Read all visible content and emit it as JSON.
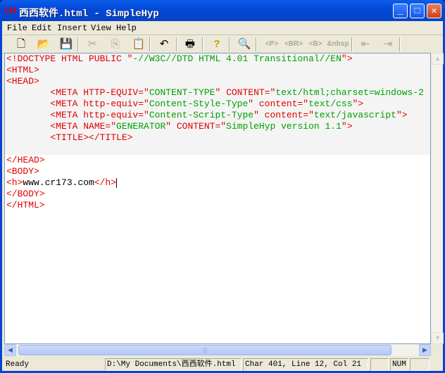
{
  "window": {
    "title": "西西软件.html - SimpleHyp",
    "logo": "SH"
  },
  "menu": [
    "File",
    "Edit",
    "Insert",
    "View",
    "Help"
  ],
  "toolbar": {
    "p": "<P>",
    "br": "<BR>",
    "b": "<B>",
    "nbsp": "&nbsp"
  },
  "code": [
    {
      "bg": true,
      "segs": [
        [
          "<!DOCTYPE HTML PUBLIC \"",
          "tag"
        ],
        [
          "-//W3C//DTD HTML 4.01 Transitional//EN",
          "val"
        ],
        [
          "\">",
          "tag"
        ]
      ]
    },
    {
      "bg": true,
      "segs": [
        [
          "<HTML>",
          "tag"
        ]
      ]
    },
    {
      "bg": true,
      "segs": [
        [
          "<HEAD>",
          "tag"
        ]
      ]
    },
    {
      "bg": true,
      "segs": [
        [
          "        <META HTTP-EQUIV=\"",
          "tag"
        ],
        [
          "CONTENT-TYPE",
          "val"
        ],
        [
          "\" CONTENT=\"",
          "tag"
        ],
        [
          "text/html;charset=windows-2",
          "val"
        ]
      ]
    },
    {
      "bg": true,
      "segs": [
        [
          "        <META http-equiv=\"",
          "tag"
        ],
        [
          "Content-Style-Type",
          "val"
        ],
        [
          "\" content=\"",
          "tag"
        ],
        [
          "text/css",
          "val"
        ],
        [
          "\">",
          "tag"
        ]
      ]
    },
    {
      "bg": true,
      "segs": [
        [
          "        <META http-equiv=\"",
          "tag"
        ],
        [
          "Content-Script-Type",
          "val"
        ],
        [
          "\" content=\"",
          "tag"
        ],
        [
          "text/javascript",
          "val"
        ],
        [
          "\">",
          "tag"
        ]
      ]
    },
    {
      "bg": true,
      "segs": [
        [
          "        <META NAME=\"",
          "tag"
        ],
        [
          "GENERATOR",
          "val"
        ],
        [
          "\" CONTENT=\"",
          "tag"
        ],
        [
          "SimpleHyp version 1.1",
          "val"
        ],
        [
          "\">",
          "tag"
        ]
      ]
    },
    {
      "bg": true,
      "segs": [
        [
          "        <TITLE></TITLE>",
          "tag"
        ]
      ]
    },
    {
      "bg": true,
      "segs": []
    },
    {
      "bg": false,
      "segs": [
        [
          "</HEAD>",
          "tag"
        ]
      ]
    },
    {
      "bg": false,
      "segs": [
        [
          "<BODY>",
          "tag"
        ]
      ]
    },
    {
      "bg": false,
      "caret": true,
      "segs": [
        [
          "<h>",
          "tag"
        ],
        [
          "www.cr173.com",
          "txt"
        ],
        [
          "</h>",
          "tag"
        ]
      ]
    },
    {
      "bg": false,
      "segs": [
        [
          "</BODY>",
          "tag"
        ]
      ]
    },
    {
      "bg": false,
      "segs": [
        [
          "</HTML>",
          "tag"
        ]
      ]
    }
  ],
  "status": {
    "ready": "Ready",
    "path": "D:\\My Documents\\西西软件.html",
    "position": "Char 401, Line 12, Col 21",
    "num": "NUM"
  }
}
